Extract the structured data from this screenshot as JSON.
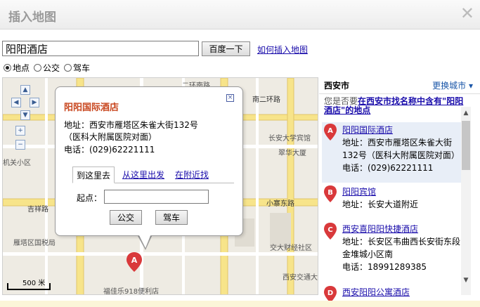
{
  "dialog": {
    "title": "插入地图",
    "close_icon": "close-icon"
  },
  "search": {
    "value": "阳阳酒店",
    "button_label": "百度一下",
    "help_link": "如何插入地图",
    "modes": [
      {
        "label": "地点",
        "checked": true
      },
      {
        "label": "公交",
        "checked": false
      },
      {
        "label": "驾车",
        "checked": false
      }
    ]
  },
  "map": {
    "labels": [
      "机关小区",
      "雁塔区国税局",
      "长安大学宾馆",
      "翠华大厦",
      "南二环路",
      "吉祥路",
      "小寨东路",
      "交大财经社区",
      "西安交通大学医院",
      "福佳乐918便利店",
      "二环南路",
      "南二环路",
      "长安大",
      "翠华路",
      "西安交大",
      "财才住宅小区",
      "吉祥路",
      "含光路",
      "芙蓉",
      "雁塔东",
      "路",
      "长"
    ],
    "scale": "500 米"
  },
  "popup": {
    "title": "阳阳国际酒店",
    "address": "地址：西安市雁塔区朱雀大街132号（医科大附属医院对面）",
    "phone": "电话：(029)62221111",
    "tabs": [
      "到这里去",
      "从这里出发",
      "在附近找"
    ],
    "start_label": "起点：",
    "btn_bus": "公交",
    "btn_drive": "驾车",
    "close": "×"
  },
  "sidebar": {
    "city": "西安市",
    "change_city": "更换城市 ▾",
    "suggest_prefix": "您是否要",
    "suggest_link": "在西安市找名称中含有\"阳阳酒店\"的地点",
    "results": [
      {
        "letter": "A",
        "name": "阳阳国际酒店",
        "lines": [
          "地址：西安市雁塔区朱雀大街",
          "132号（医科大附属医院对面）",
          "电话：(029)62221111"
        ]
      },
      {
        "letter": "B",
        "name": "阳阳宾馆",
        "lines": [
          "地址：长安大道附近"
        ]
      },
      {
        "letter": "C",
        "name": "西安喜阳阳快捷酒店",
        "lines": [
          "地址：长安区韦曲西长安街东段",
          "金堆城小区南",
          "电话：18991289385"
        ]
      },
      {
        "letter": "D",
        "name": "西安阳阳公寓酒店",
        "lines": []
      }
    ]
  },
  "colors": {
    "accent": "#d9393b",
    "link": "#1a0dab",
    "title": "#c8461e"
  }
}
